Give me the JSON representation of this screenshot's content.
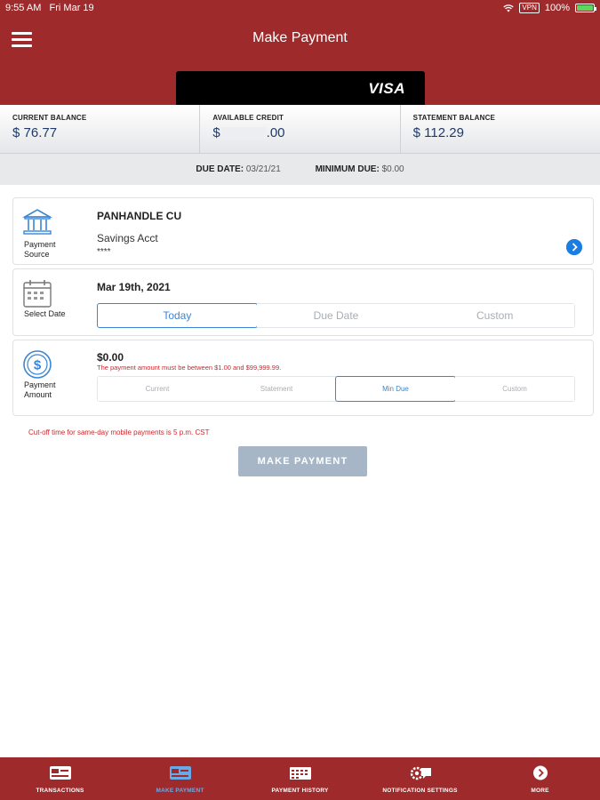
{
  "status_bar": {
    "time": "9:55 AM",
    "date": "Fri Mar 19",
    "vpn": "VPN",
    "battery": "100%"
  },
  "header": {
    "title": "Make Payment"
  },
  "card": {
    "brand": "VISA"
  },
  "balances": [
    {
      "label": "CURRENT BALANCE",
      "value": "$ 76.77"
    },
    {
      "label": "AVAILABLE CREDIT",
      "value_prefix": "$",
      "value_suffix": ".00"
    },
    {
      "label": "STATEMENT BALANCE",
      "value": "$ 112.29"
    }
  ],
  "due": {
    "due_label": "DUE DATE:",
    "due_value": "03/21/21",
    "min_label": "MINIMUM DUE:",
    "min_value": "$0.00"
  },
  "source": {
    "caption_line1": "Payment",
    "caption_line2": "Source",
    "bank": "PANHANDLE CU",
    "account": "Savings Acct",
    "mask": "****"
  },
  "date": {
    "caption": "Select Date",
    "value": "Mar 19th, 2021",
    "options": [
      "Today",
      "Due Date",
      "Custom"
    ],
    "selected": "Today"
  },
  "amount": {
    "caption_line1": "Payment",
    "caption_line2": "Amount",
    "value": "$0.00",
    "error": "The payment amount must be between $1.00 and $99,999.99.",
    "options": [
      "Current",
      "Statement",
      "Min Due",
      "Custom"
    ],
    "selected": "Min Due"
  },
  "cutoff_note": "Cut-off time for same-day mobile payments is 5 p.m. CST",
  "submit_label": "MAKE PAYMENT",
  "tabs": [
    {
      "label": "TRANSACTIONS",
      "icon": "card-icon"
    },
    {
      "label": "MAKE PAYMENT",
      "icon": "payment-card-icon",
      "active": true
    },
    {
      "label": "PAYMENT HISTORY",
      "icon": "calendar-grid-icon"
    },
    {
      "label": "NOTIFICATION SETTINGS",
      "icon": "gear-chat-icon"
    },
    {
      "label": "MORE",
      "icon": "chevron-right-circle-icon"
    }
  ],
  "colors": {
    "brand": "#9e2a2b",
    "accent": "#3a86d4",
    "error": "#d0262a",
    "value": "#1f3a6b"
  }
}
